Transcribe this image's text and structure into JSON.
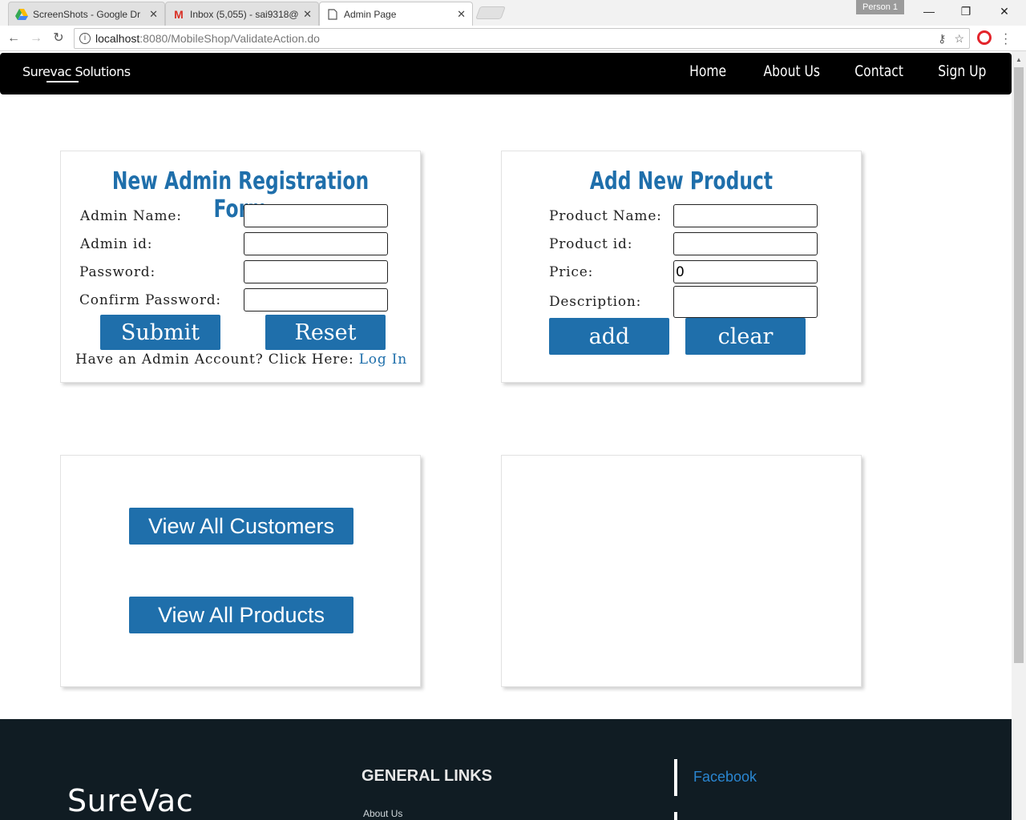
{
  "browser": {
    "tabs": [
      {
        "title": "ScreenShots - Google Dr",
        "icon": "google-drive-icon"
      },
      {
        "title": "Inbox (5,055) - sai9318@",
        "icon": "gmail-icon"
      },
      {
        "title": "Admin Page",
        "icon": "page-icon",
        "active": true
      }
    ],
    "profile": "Person 1",
    "url_host": "localhost",
    "url_path": ":8080/MobileShop/ValidateAction.do"
  },
  "navbar": {
    "brand": "Surevac Solutions",
    "links": [
      "Home",
      "About Us",
      "Contact",
      "Sign Up"
    ]
  },
  "admin_form": {
    "title": "New Admin Registration Form",
    "labels": {
      "name": "Admin Name:",
      "id": "Admin id:",
      "password": "Password:",
      "confirm": "Confirm Password:"
    },
    "submit": "Submit",
    "reset": "Reset",
    "login_prompt": "Have an Admin Account? Click Here:",
    "login_link": "Log In"
  },
  "product_form": {
    "title": "Add New Product",
    "labels": {
      "name": "Product Name:",
      "id": "Product id:",
      "price": "Price:",
      "description": "Description:"
    },
    "price_value": "0",
    "add": "add",
    "clear": "clear"
  },
  "view_buttons": {
    "customers": "View All Customers",
    "products": "View All Products"
  },
  "footer": {
    "logo": "SureVac",
    "general_links_heading": "GENERAL LINKS",
    "general_links": [
      "About Us"
    ],
    "social": [
      "Facebook"
    ]
  },
  "colors": {
    "accent": "#1f6fab",
    "navbar_bg": "#000000",
    "footer_bg": "#101c23"
  }
}
